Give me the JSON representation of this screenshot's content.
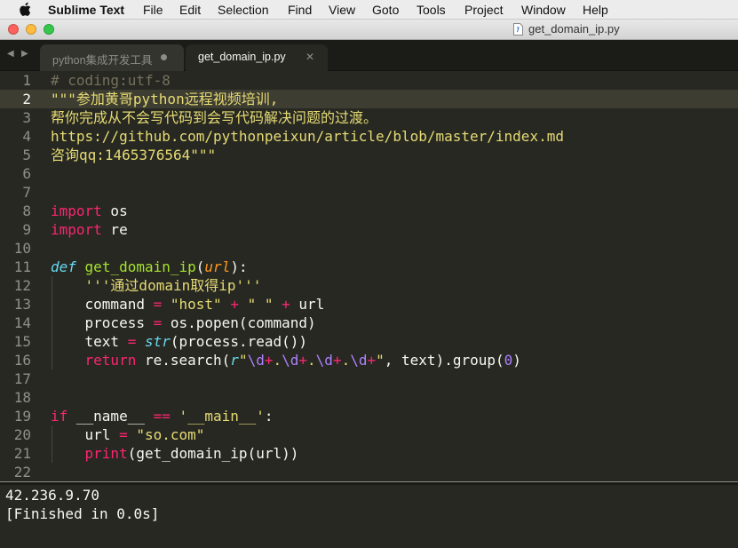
{
  "menubar": {
    "app_name": "Sublime Text",
    "items": [
      "File",
      "Edit",
      "Selection",
      "Find",
      "View",
      "Goto",
      "Tools",
      "Project",
      "Window",
      "Help"
    ]
  },
  "window": {
    "title": "get_domain_ip.py",
    "traffic_light_colors": [
      "#fc615d",
      "#fdbc40",
      "#34c84a"
    ]
  },
  "tabs": [
    {
      "label": "python集成开发工具",
      "active": false,
      "modified": true
    },
    {
      "label": "get_domain_ip.py",
      "active": true,
      "modified": false
    }
  ],
  "editor": {
    "current_line": 2,
    "theme_colors": {
      "background": "#272822",
      "comment": "#75715e",
      "string": "#e6db74",
      "keyword": "#f92672",
      "function": "#a6e22e",
      "builtin": "#66d9ef",
      "parameter": "#fd971f",
      "number": "#ae81ff"
    },
    "lines": [
      {
        "n": "1",
        "tokens": [
          {
            "t": "cm",
            "v": "# coding:utf-8"
          }
        ]
      },
      {
        "n": "2",
        "tokens": [
          {
            "t": "st",
            "v": "\"\"\"参加黄哥python远程视频培训,"
          }
        ]
      },
      {
        "n": "3",
        "tokens": [
          {
            "t": "st",
            "v": "帮你完成从不会写代码到会写代码解决问题的过渡。"
          }
        ]
      },
      {
        "n": "4",
        "tokens": [
          {
            "t": "st",
            "v": "https://github.com/pythonpeixun/article/blob/master/index.md"
          }
        ]
      },
      {
        "n": "5",
        "tokens": [
          {
            "t": "st",
            "v": "咨询qq:1465376564\"\"\""
          }
        ]
      },
      {
        "n": "6",
        "tokens": []
      },
      {
        "n": "7",
        "tokens": []
      },
      {
        "n": "8",
        "tokens": [
          {
            "t": "kw",
            "v": "import"
          },
          {
            "t": "sp",
            "v": " os"
          }
        ]
      },
      {
        "n": "9",
        "tokens": [
          {
            "t": "kw",
            "v": "import"
          },
          {
            "t": "sp",
            "v": " re"
          }
        ]
      },
      {
        "n": "10",
        "tokens": []
      },
      {
        "n": "11",
        "tokens": [
          {
            "t": "df",
            "v": "def"
          },
          {
            "t": "sp",
            "v": " "
          },
          {
            "t": "fn",
            "v": "get_domain_ip"
          },
          {
            "t": "sp",
            "v": "("
          },
          {
            "t": "pa",
            "v": "url"
          },
          {
            "t": "sp",
            "v": "):"
          }
        ]
      },
      {
        "n": "12",
        "tokens": [
          {
            "t": "sp",
            "v": "    "
          },
          {
            "t": "st",
            "v": "'''通过domain取得ip'''"
          }
        ]
      },
      {
        "n": "13",
        "tokens": [
          {
            "t": "sp",
            "v": "    command "
          },
          {
            "t": "kw",
            "v": "="
          },
          {
            "t": "sp",
            "v": " "
          },
          {
            "t": "st",
            "v": "\"host\""
          },
          {
            "t": "sp",
            "v": " "
          },
          {
            "t": "kw",
            "v": "+"
          },
          {
            "t": "sp",
            "v": " "
          },
          {
            "t": "st",
            "v": "\" \""
          },
          {
            "t": "sp",
            "v": " "
          },
          {
            "t": "kw",
            "v": "+"
          },
          {
            "t": "sp",
            "v": " url"
          }
        ]
      },
      {
        "n": "14",
        "tokens": [
          {
            "t": "sp",
            "v": "    process "
          },
          {
            "t": "kw",
            "v": "="
          },
          {
            "t": "sp",
            "v": " os.popen(command)"
          }
        ]
      },
      {
        "n": "15",
        "tokens": [
          {
            "t": "sp",
            "v": "    text "
          },
          {
            "t": "kw",
            "v": "="
          },
          {
            "t": "sp",
            "v": " "
          },
          {
            "t": "bi",
            "v": "str"
          },
          {
            "t": "sp",
            "v": "(process.read())"
          }
        ]
      },
      {
        "n": "16",
        "tokens": [
          {
            "t": "sp",
            "v": "    "
          },
          {
            "t": "kw",
            "v": "return"
          },
          {
            "t": "sp",
            "v": " re.search("
          },
          {
            "t": "bi",
            "v": "r"
          },
          {
            "t": "st",
            "v": "\""
          },
          {
            "t": "rx",
            "v": "\\d"
          },
          {
            "t": "kw",
            "v": "+"
          },
          {
            "t": "st",
            "v": "."
          },
          {
            "t": "rx",
            "v": "\\d"
          },
          {
            "t": "kw",
            "v": "+"
          },
          {
            "t": "st",
            "v": "."
          },
          {
            "t": "rx",
            "v": "\\d"
          },
          {
            "t": "kw",
            "v": "+"
          },
          {
            "t": "st",
            "v": "."
          },
          {
            "t": "rx",
            "v": "\\d"
          },
          {
            "t": "kw",
            "v": "+"
          },
          {
            "t": "st",
            "v": "\""
          },
          {
            "t": "sp",
            "v": ", text).group("
          },
          {
            "t": "nu",
            "v": "0"
          },
          {
            "t": "sp",
            "v": ")"
          }
        ]
      },
      {
        "n": "17",
        "tokens": []
      },
      {
        "n": "18",
        "tokens": []
      },
      {
        "n": "19",
        "tokens": [
          {
            "t": "kw",
            "v": "if"
          },
          {
            "t": "sp",
            "v": " __name__ "
          },
          {
            "t": "kw",
            "v": "=="
          },
          {
            "t": "sp",
            "v": " "
          },
          {
            "t": "st",
            "v": "'__main__'"
          },
          {
            "t": "sp",
            "v": ":"
          }
        ]
      },
      {
        "n": "20",
        "tokens": [
          {
            "t": "sp",
            "v": "    url "
          },
          {
            "t": "kw",
            "v": "="
          },
          {
            "t": "sp",
            "v": " "
          },
          {
            "t": "st",
            "v": "\"so.com\""
          }
        ]
      },
      {
        "n": "21",
        "tokens": [
          {
            "t": "sp",
            "v": "    "
          },
          {
            "t": "kw",
            "v": "print"
          },
          {
            "t": "sp",
            "v": "(get_domain_ip(url))"
          }
        ]
      },
      {
        "n": "22",
        "tokens": []
      }
    ]
  },
  "output": {
    "lines": [
      "42.236.9.70",
      "[Finished in 0.0s]"
    ]
  }
}
